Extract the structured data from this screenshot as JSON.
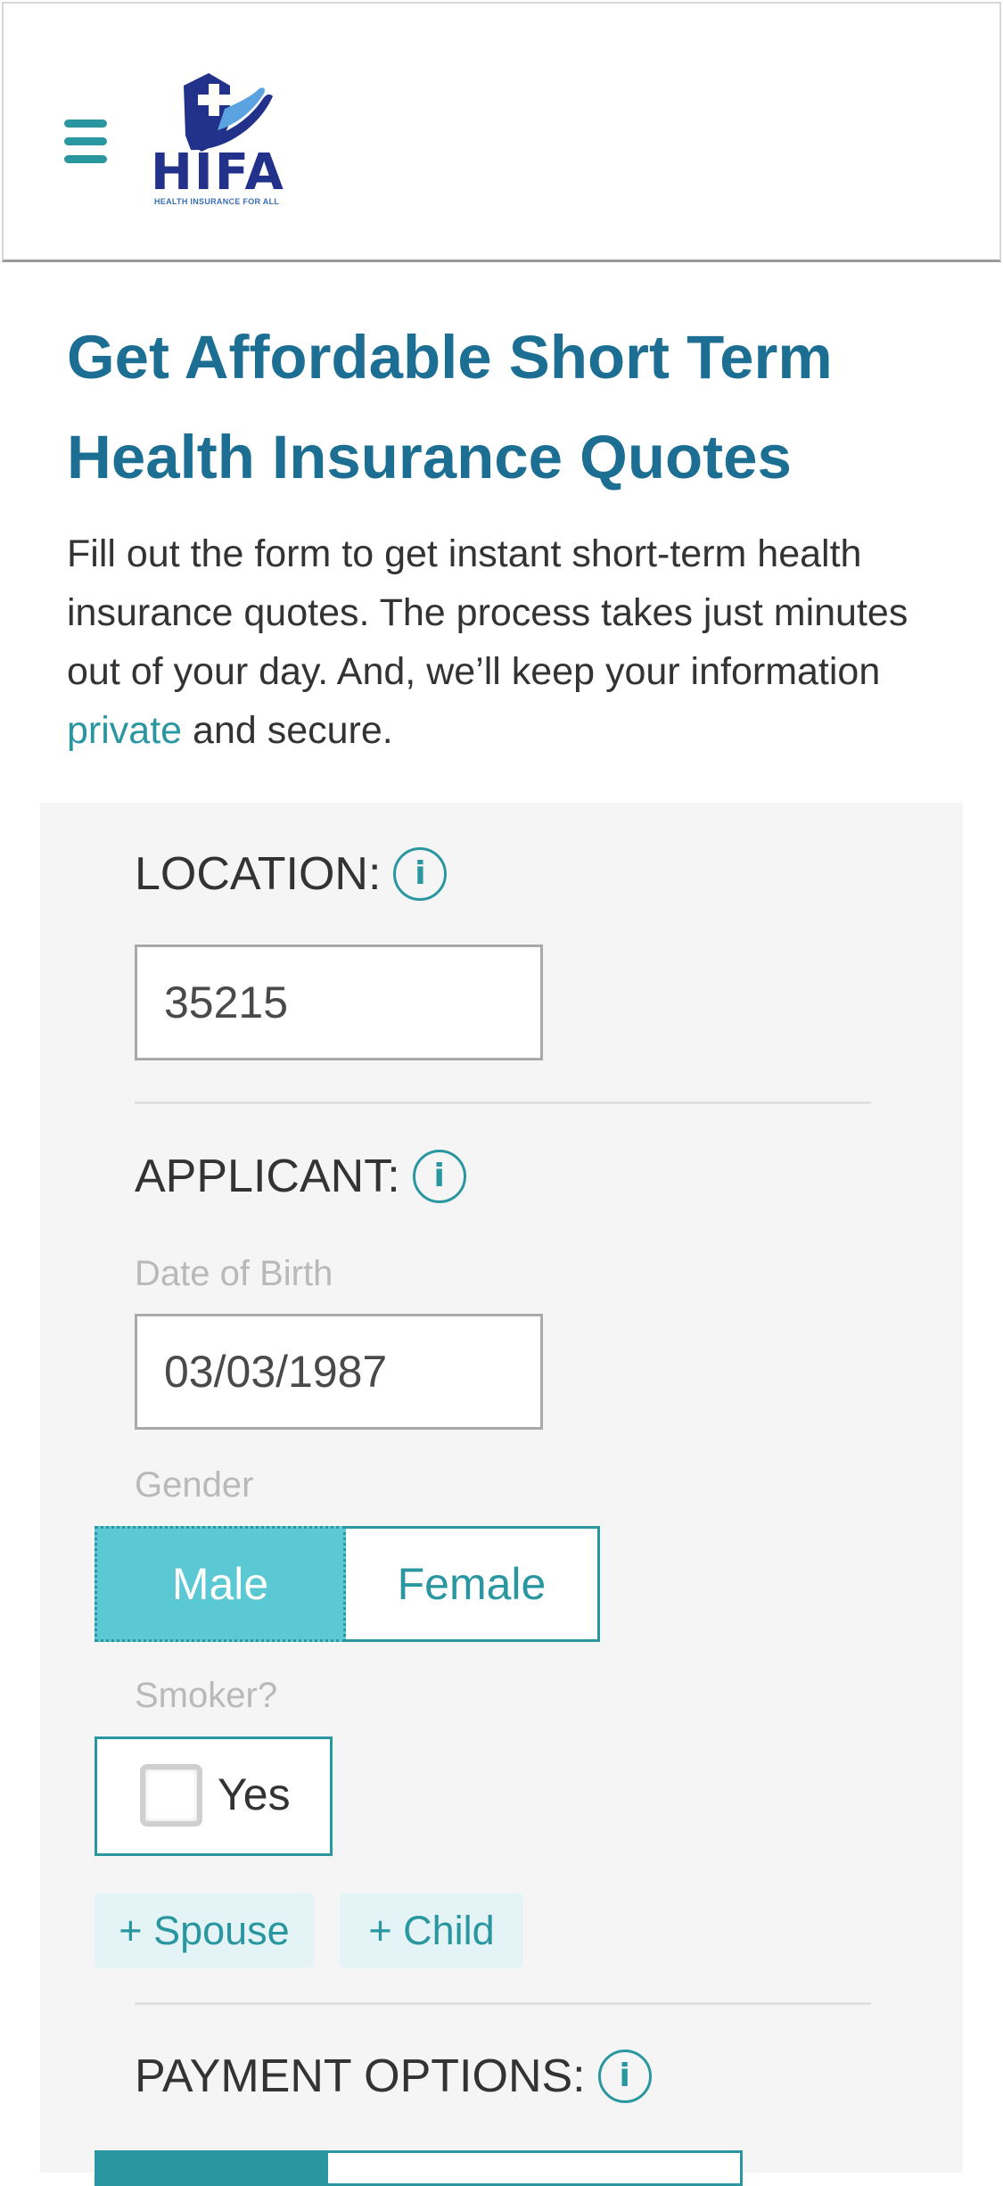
{
  "header": {
    "logo": {
      "name": "HIFA",
      "tagline": "HEALTH INSURANCE FOR ALL"
    },
    "menu_icon": "hamburger-menu-icon"
  },
  "page": {
    "title": "Get Affordable Short Term Health Insurance Quotes",
    "intro_before": "Fill out the form to get instant short-term health insurance quotes. The process takes just minutes out of your day. And, we’ll keep your information ",
    "intro_link": "private",
    "intro_after": " and secure."
  },
  "form": {
    "location": {
      "label": "LOCATION:",
      "value": "35215"
    },
    "applicant": {
      "label": "APPLICANT:",
      "dob_label": "Date of Birth",
      "dob_value": "03/03/1987",
      "gender_label": "Gender",
      "gender_options": [
        "Male",
        "Female"
      ],
      "gender_selected": "Male",
      "smoker_label": "Smoker?",
      "smoker_option": "Yes",
      "smoker_checked": false,
      "add_spouse": "+ Spouse",
      "add_child": "+ Child"
    },
    "payment": {
      "label": "PAYMENT OPTIONS:"
    },
    "info_icon_glyph": "i"
  },
  "colors": {
    "teal": "#2a97a0",
    "title_blue": "#1c6f93",
    "selected_fill": "#5bc9d3",
    "logo_navy": "#22328a",
    "logo_light_blue": "#5aa3e0"
  }
}
